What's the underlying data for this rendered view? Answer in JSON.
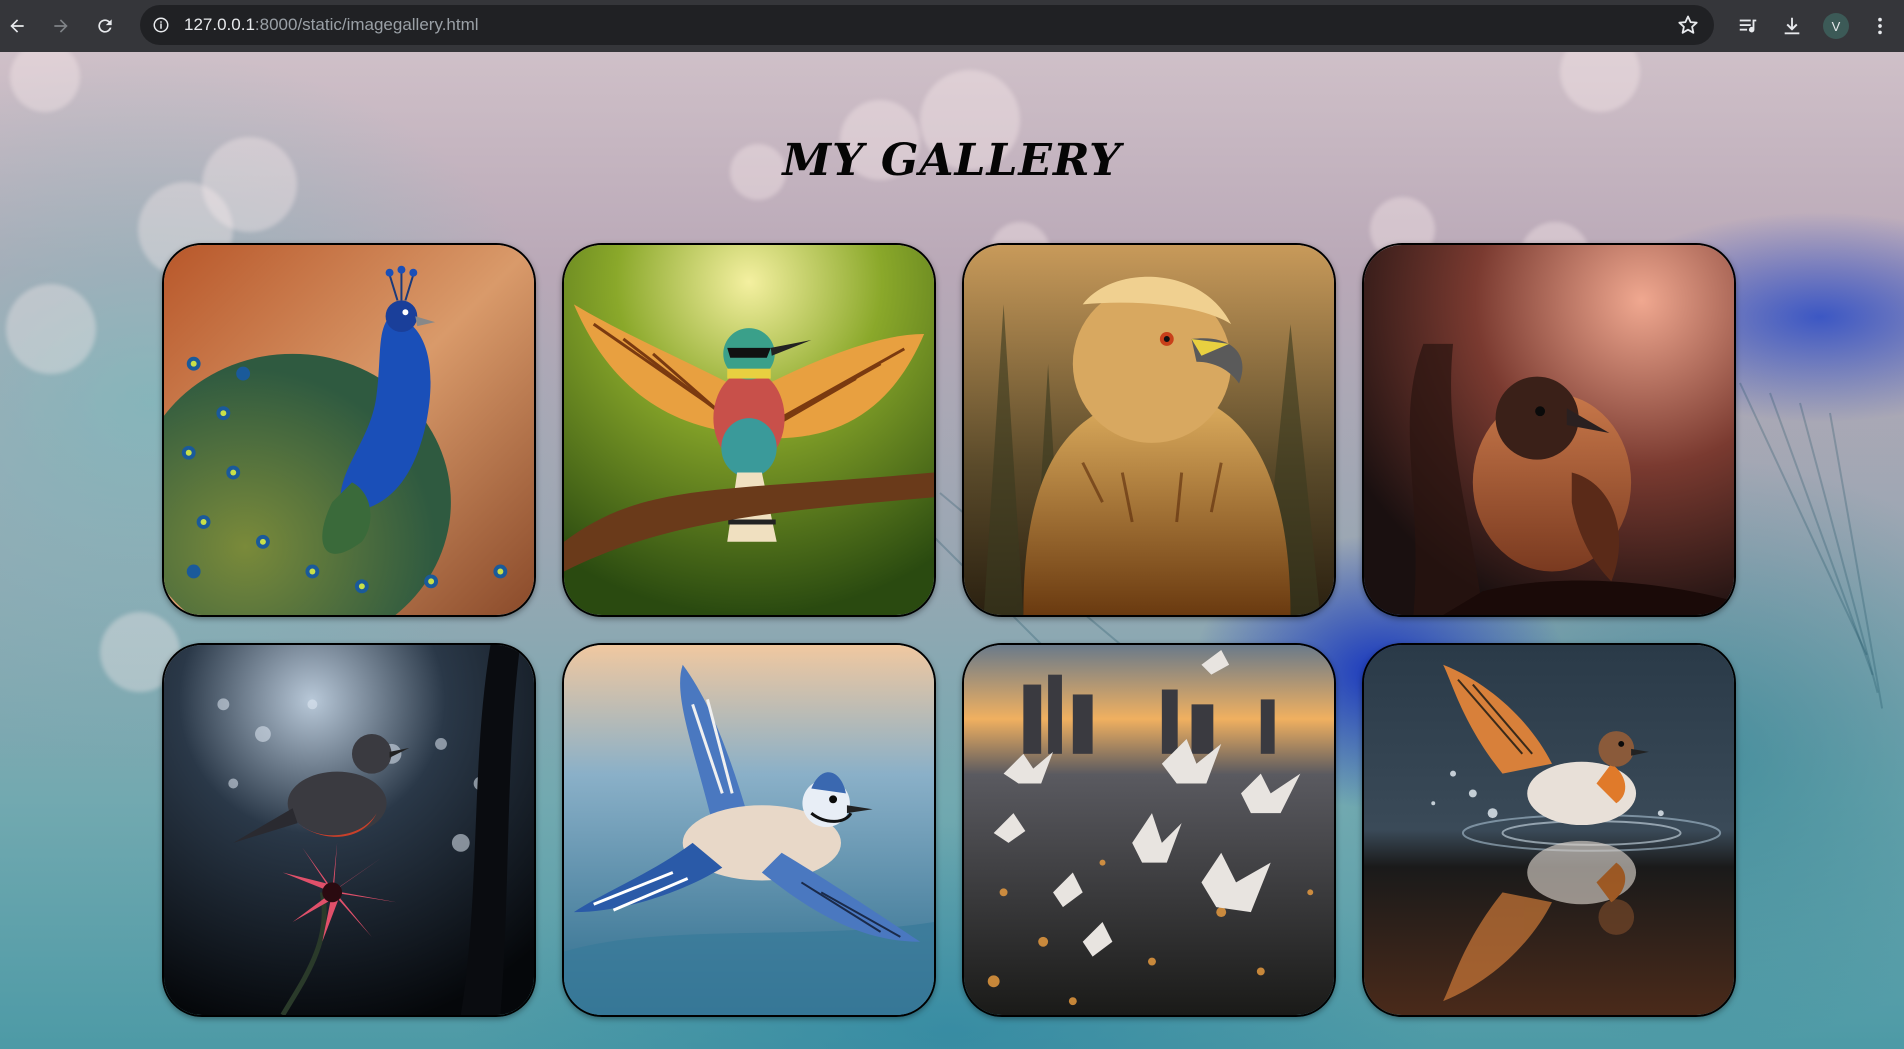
{
  "browser": {
    "url_host": "127.0.0.1",
    "url_path": ":8000/static/imagegallery.html",
    "profile_initial": "V"
  },
  "page": {
    "title": "MY GALLERY"
  },
  "gallery": {
    "images": [
      {
        "name": "peacock-image",
        "subject": "peacock"
      },
      {
        "name": "bee-eater-image",
        "subject": "colorful bird with spread wings on branch"
      },
      {
        "name": "eagle-image",
        "subject": "golden eagle"
      },
      {
        "name": "small-bird-image",
        "subject": "small brown bird on branch"
      },
      {
        "name": "robin-flower-image",
        "subject": "bird on red flower at night"
      },
      {
        "name": "blue-jay-image",
        "subject": "blue jay in flight"
      },
      {
        "name": "doves-city-image",
        "subject": "doves flying over city at sunset"
      },
      {
        "name": "bird-water-image",
        "subject": "bird splashing on water with reflection"
      }
    ]
  },
  "colors": {
    "chrome_bar": "#35363a",
    "omnibox": "#202124",
    "title_text": "#050505"
  }
}
